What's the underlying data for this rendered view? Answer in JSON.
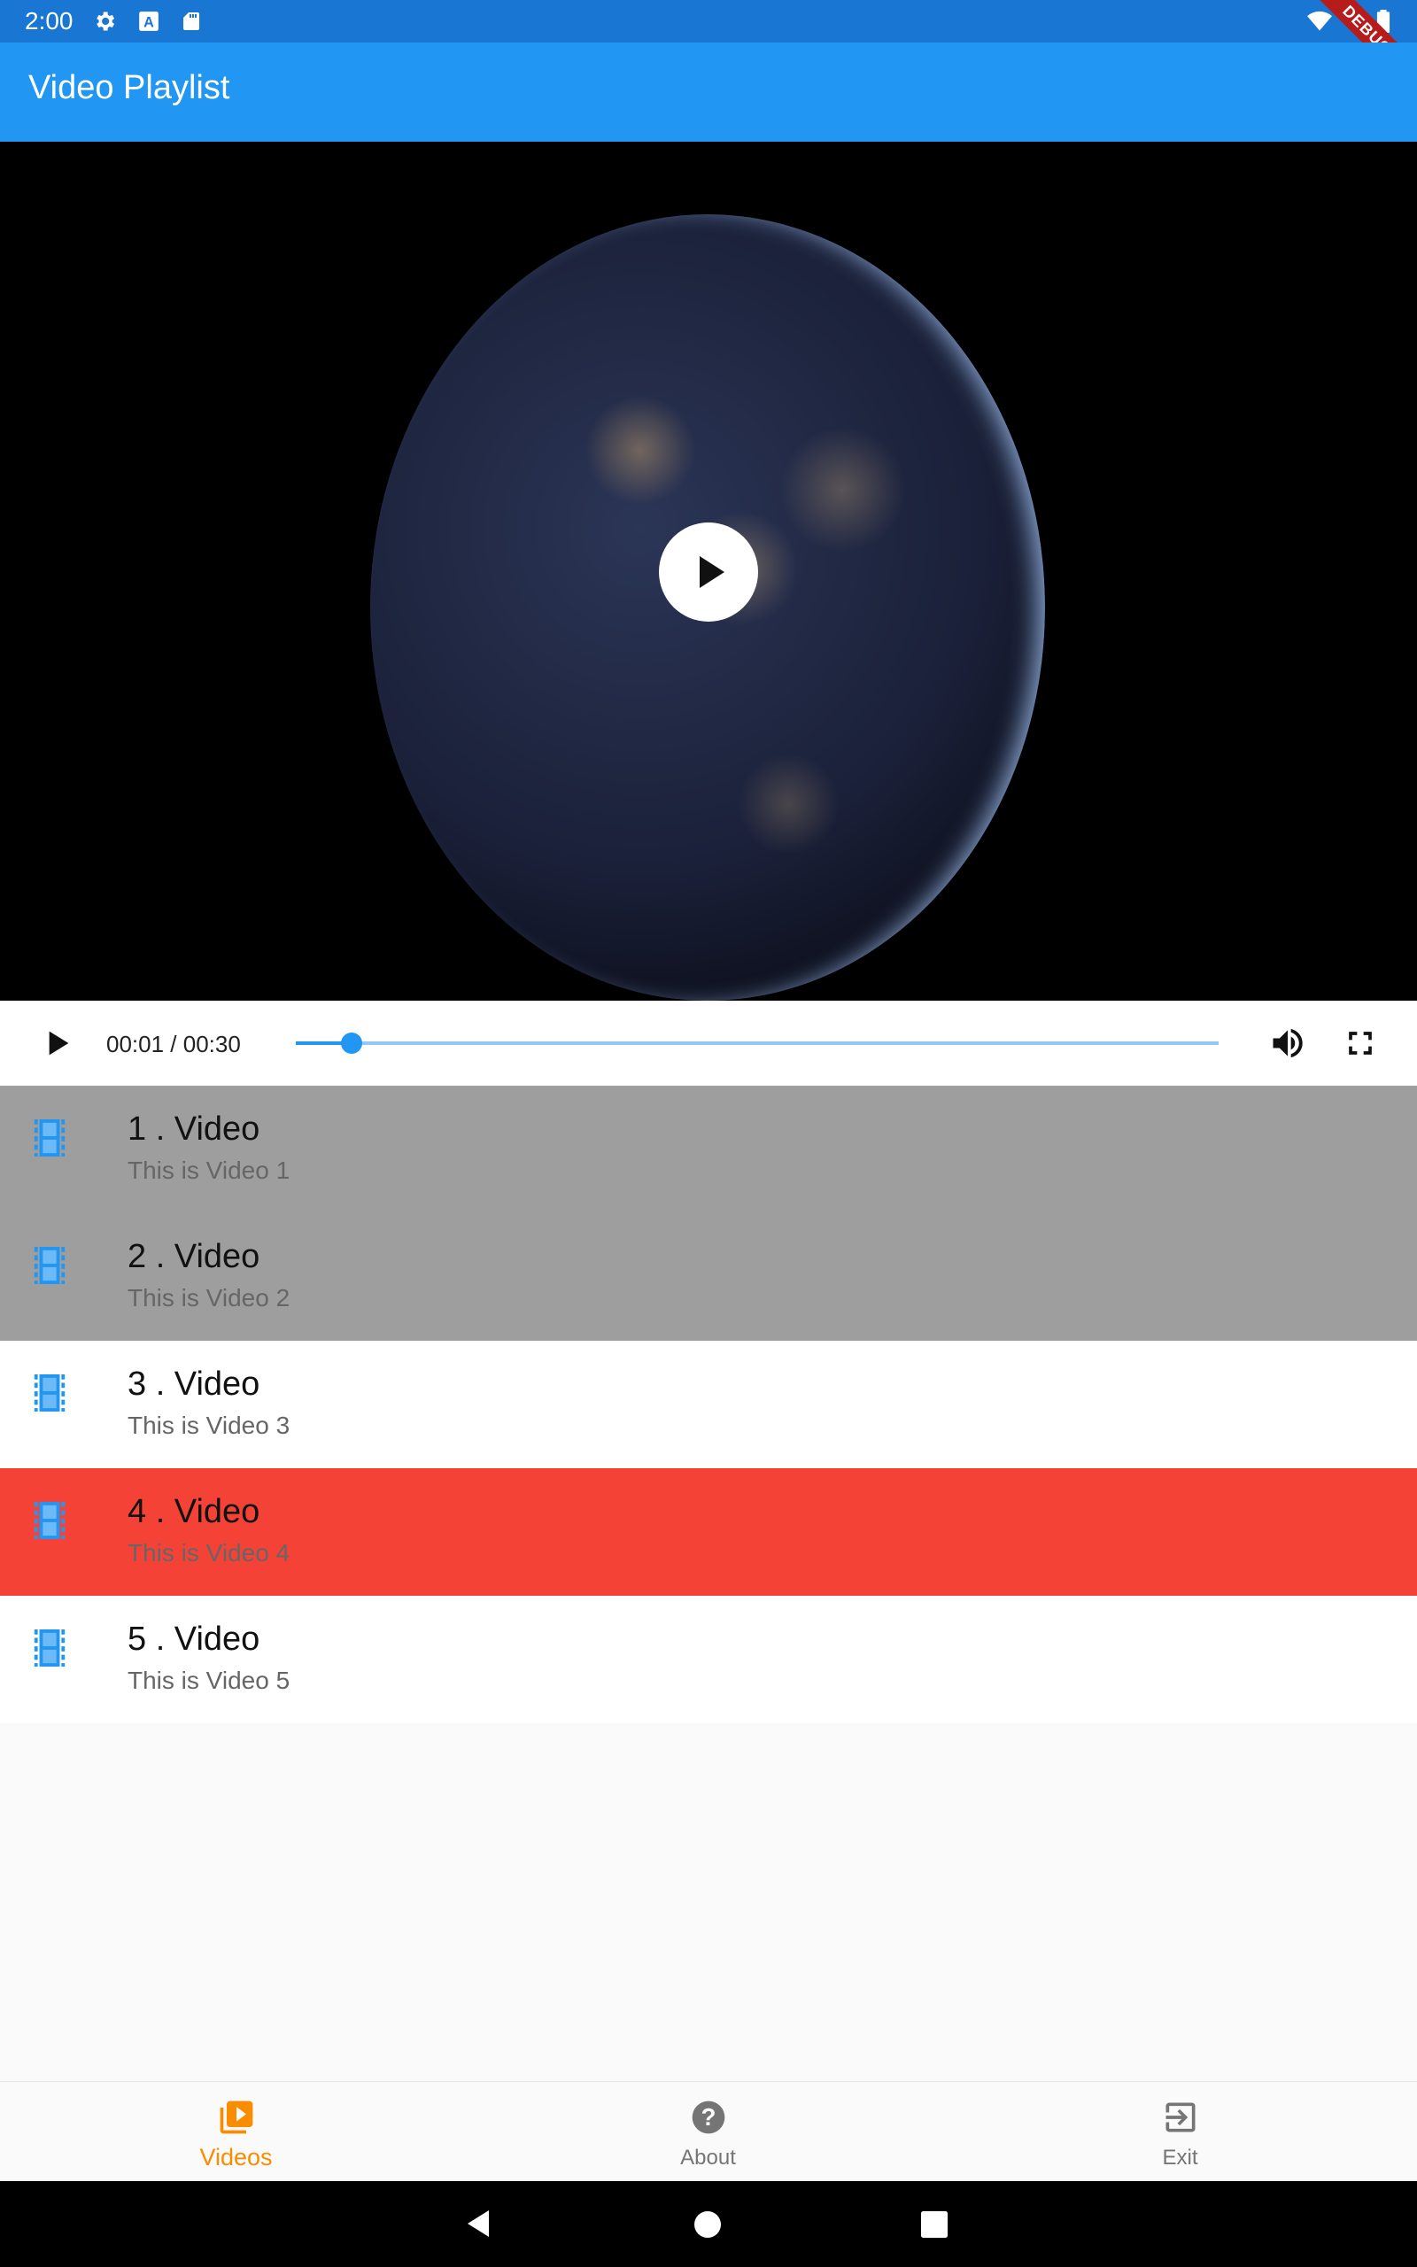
{
  "status_bar": {
    "time": "2:00",
    "debug": "DEBUG"
  },
  "app_bar": {
    "title": "Video Playlist"
  },
  "player": {
    "time_display": "00:01 / 00:30",
    "progress": 0.06,
    "accent": "#2196f3"
  },
  "playlist": [
    {
      "title": "1 . Video",
      "subtitle": "This is Video 1",
      "background": "#9e9e9e"
    },
    {
      "title": "2 . Video",
      "subtitle": "This is Video 2",
      "background": "#9e9e9e"
    },
    {
      "title": "3 . Video",
      "subtitle": "This is Video 3",
      "background": "#ffffff"
    },
    {
      "title": "4 . Video",
      "subtitle": "This is Video 4",
      "background": "#f44336"
    },
    {
      "title": "5 . Video",
      "subtitle": "This is Video 5",
      "background": "#ffffff"
    }
  ],
  "bottom_nav": {
    "items": [
      {
        "label": "Videos",
        "icon": "video-library-icon",
        "active": true
      },
      {
        "label": "About",
        "icon": "help-icon",
        "active": false
      },
      {
        "label": "Exit",
        "icon": "exit-icon",
        "active": false
      }
    ],
    "active_color": "#fb8c00"
  }
}
